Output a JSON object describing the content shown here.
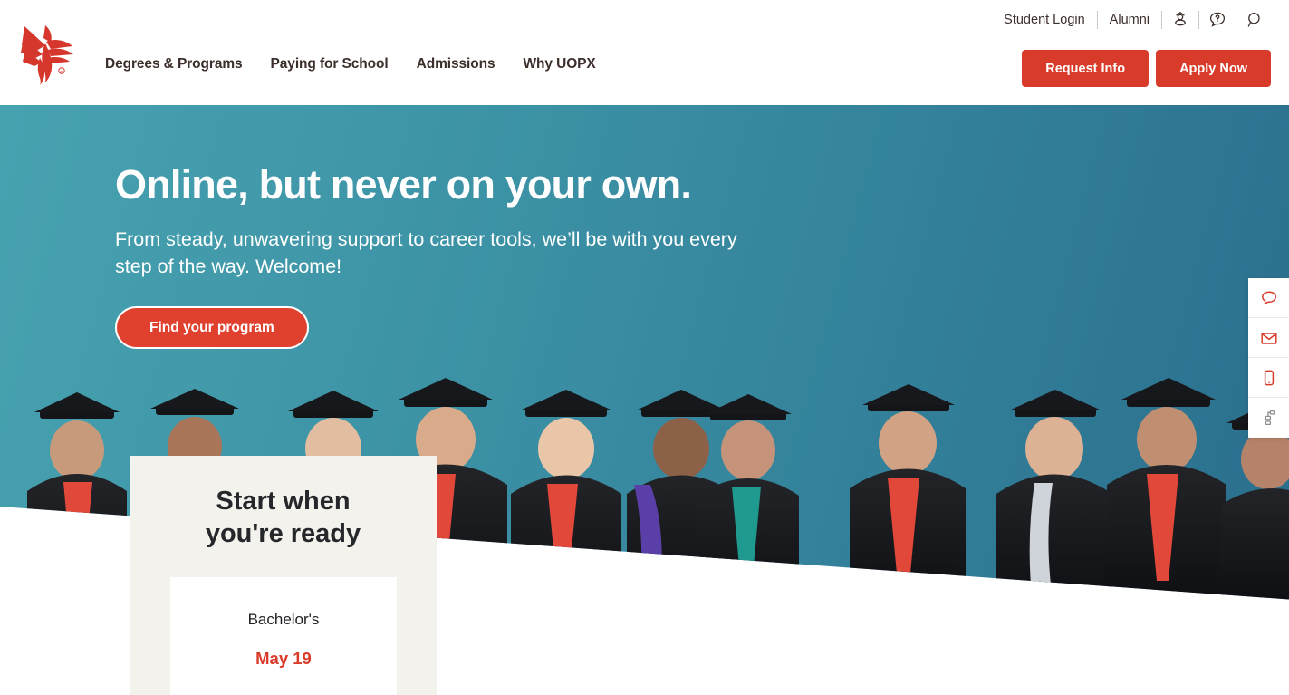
{
  "header": {
    "logo_alt": "University of Phoenix",
    "utility": {
      "links": [
        {
          "label": "Student Login"
        },
        {
          "label": "Alumni"
        }
      ],
      "icons": [
        {
          "name": "location-pin-icon"
        },
        {
          "name": "help-chat-icon"
        },
        {
          "name": "search-icon"
        }
      ]
    },
    "nav": [
      {
        "label": "Degrees & Programs"
      },
      {
        "label": "Paying for School"
      },
      {
        "label": "Admissions"
      },
      {
        "label": "Why UOPX"
      }
    ],
    "cta": {
      "request_info": "Request Info",
      "apply_now": "Apply Now"
    }
  },
  "hero": {
    "title": "Online, but never on your own.",
    "subtitle": "From steady, unwavering support to career tools, we’ll be with you every step of the way. Welcome!",
    "cta_label": "Find your program",
    "gradient_from": "#47a2b0",
    "gradient_to": "#2a6f8d"
  },
  "start_card": {
    "title": "Start when\nyou're ready",
    "level": "Bachelor's",
    "date": "May 19",
    "background": "#f4f2ed",
    "date_color": "#d93b2b"
  },
  "side_widget": {
    "items": [
      {
        "name": "chat-icon"
      },
      {
        "name": "email-icon"
      },
      {
        "name": "mobile-icon"
      },
      {
        "name": "share-icon"
      }
    ]
  },
  "colors": {
    "brand_red": "#d93b2b",
    "nav_text": "#3c2f2b"
  }
}
